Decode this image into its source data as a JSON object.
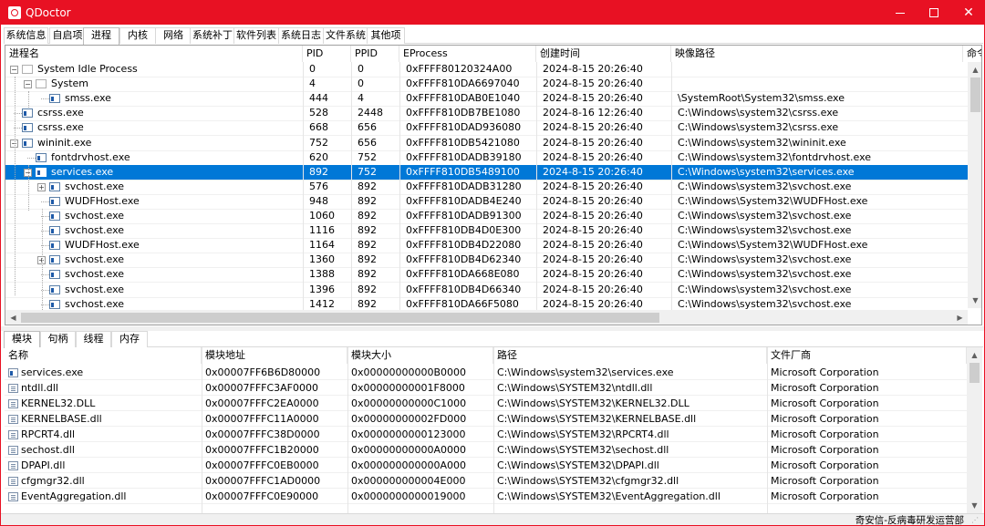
{
  "window": {
    "title": "QDoctor",
    "minimize_icon": "minimize-icon",
    "maximize_icon": "maximize-icon",
    "close_glyph": "✕",
    "accent_color": "#e81123"
  },
  "tabs": [
    "系统信息",
    "自启项",
    "进程",
    "内核",
    "网络",
    "系统补丁",
    "软件列表",
    "系统日志",
    "文件系统",
    "其他项"
  ],
  "active_tab_index": 2,
  "process_table": {
    "columns": [
      "进程名",
      "PID",
      "PPID",
      "EProcess",
      "创建时间",
      "映像路径",
      "命令"
    ],
    "rows": [
      {
        "name": "System Idle Process",
        "pid": "0",
        "ppid": "0",
        "eprocess": "0xFFFF80120324A00",
        "created": "2024-8-15 20:26:40",
        "path": "",
        "level": 0,
        "expander": "−",
        "icon": "blank"
      },
      {
        "name": "System",
        "pid": "4",
        "ppid": "0",
        "eprocess": "0xFFFF810DA6697040",
        "created": "2024-8-15 20:26:40",
        "path": "",
        "level": 1,
        "expander": "−",
        "icon": "blank"
      },
      {
        "name": "smss.exe",
        "pid": "444",
        "ppid": "4",
        "eprocess": "0xFFFF810DAB0E1040",
        "created": "2024-8-15 20:26:40",
        "path": "\\SystemRoot\\System32\\smss.exe",
        "level": 2,
        "expander": "",
        "icon": "exe"
      },
      {
        "name": "csrss.exe",
        "pid": "528",
        "ppid": "2448",
        "eprocess": "0xFFFF810DB7BE1080",
        "created": "2024-8-16 12:26:40",
        "path": "C:\\Windows\\system32\\csrss.exe",
        "level": 0,
        "expander": "",
        "icon": "exe"
      },
      {
        "name": "csrss.exe",
        "pid": "668",
        "ppid": "656",
        "eprocess": "0xFFFF810DAD936080",
        "created": "2024-8-15 20:26:40",
        "path": "C:\\Windows\\system32\\csrss.exe",
        "level": 0,
        "expander": "",
        "icon": "exe"
      },
      {
        "name": "wininit.exe",
        "pid": "752",
        "ppid": "656",
        "eprocess": "0xFFFF810DB5421080",
        "created": "2024-8-15 20:26:40",
        "path": "C:\\Windows\\system32\\wininit.exe",
        "level": 0,
        "expander": "−",
        "icon": "exe"
      },
      {
        "name": "fontdrvhost.exe",
        "pid": "620",
        "ppid": "752",
        "eprocess": "0xFFFF810DADB39180",
        "created": "2024-8-15 20:26:40",
        "path": "C:\\Windows\\system32\\fontdrvhost.exe",
        "level": 1,
        "expander": "",
        "icon": "exe"
      },
      {
        "name": "services.exe",
        "pid": "892",
        "ppid": "752",
        "eprocess": "0xFFFF810DB5489100",
        "created": "2024-8-15 20:26:40",
        "path": "C:\\Windows\\system32\\services.exe",
        "level": 1,
        "expander": "−",
        "icon": "exe",
        "selected": true
      },
      {
        "name": "svchost.exe",
        "pid": "576",
        "ppid": "892",
        "eprocess": "0xFFFF810DADB31280",
        "created": "2024-8-15 20:26:40",
        "path": "C:\\Windows\\system32\\svchost.exe",
        "level": 2,
        "expander": "+",
        "icon": "exe"
      },
      {
        "name": "WUDFHost.exe",
        "pid": "948",
        "ppid": "892",
        "eprocess": "0xFFFF810DADB4E240",
        "created": "2024-8-15 20:26:40",
        "path": "C:\\Windows\\System32\\WUDFHost.exe",
        "level": 2,
        "expander": "",
        "icon": "exe"
      },
      {
        "name": "svchost.exe",
        "pid": "1060",
        "ppid": "892",
        "eprocess": "0xFFFF810DADB91300",
        "created": "2024-8-15 20:26:40",
        "path": "C:\\Windows\\system32\\svchost.exe",
        "level": 2,
        "expander": "",
        "icon": "exe"
      },
      {
        "name": "svchost.exe",
        "pid": "1116",
        "ppid": "892",
        "eprocess": "0xFFFF810DB4D0E300",
        "created": "2024-8-15 20:26:40",
        "path": "C:\\Windows\\system32\\svchost.exe",
        "level": 2,
        "expander": "",
        "icon": "exe"
      },
      {
        "name": "WUDFHost.exe",
        "pid": "1164",
        "ppid": "892",
        "eprocess": "0xFFFF810DB4D22080",
        "created": "2024-8-15 20:26:40",
        "path": "C:\\Windows\\System32\\WUDFHost.exe",
        "level": 2,
        "expander": "",
        "icon": "exe"
      },
      {
        "name": "svchost.exe",
        "pid": "1360",
        "ppid": "892",
        "eprocess": "0xFFFF810DB4D62340",
        "created": "2024-8-15 20:26:40",
        "path": "C:\\Windows\\system32\\svchost.exe",
        "level": 2,
        "expander": "+",
        "icon": "exe"
      },
      {
        "name": "svchost.exe",
        "pid": "1388",
        "ppid": "892",
        "eprocess": "0xFFFF810DA668E080",
        "created": "2024-8-15 20:26:40",
        "path": "C:\\Windows\\system32\\svchost.exe",
        "level": 2,
        "expander": "",
        "icon": "exe"
      },
      {
        "name": "svchost.exe",
        "pid": "1396",
        "ppid": "892",
        "eprocess": "0xFFFF810DB4D66340",
        "created": "2024-8-15 20:26:40",
        "path": "C:\\Windows\\system32\\svchost.exe",
        "level": 2,
        "expander": "",
        "icon": "exe"
      },
      {
        "name": "svchost.exe",
        "pid": "1412",
        "ppid": "892",
        "eprocess": "0xFFFF810DA66F5080",
        "created": "2024-8-15 20:26:40",
        "path": "C:\\Windows\\system32\\svchost.exe",
        "level": 2,
        "expander": "",
        "icon": "exe"
      }
    ]
  },
  "bottom_tabs": [
    "模块",
    "句柄",
    "线程",
    "内存"
  ],
  "active_bottom_tab_index": 0,
  "module_table": {
    "columns": [
      "名称",
      "模块地址",
      "模块大小",
      "路径",
      "文件厂商"
    ],
    "rows": [
      {
        "name": "services.exe",
        "base": "0x00007FF6B6D80000",
        "size": "0x00000000000B0000",
        "path": "C:\\Windows\\system32\\services.exe",
        "vendor": "Microsoft Corporation",
        "icon": "exe"
      },
      {
        "name": "ntdll.dll",
        "base": "0x00007FFFC3AF0000",
        "size": "0x00000000001F8000",
        "path": "C:\\Windows\\SYSTEM32\\ntdll.dll",
        "vendor": "Microsoft Corporation",
        "icon": "dll"
      },
      {
        "name": "KERNEL32.DLL",
        "base": "0x00007FFFC2EA0000",
        "size": "0x00000000000C1000",
        "path": "C:\\Windows\\SYSTEM32\\KERNEL32.DLL",
        "vendor": "Microsoft Corporation",
        "icon": "dll"
      },
      {
        "name": "KERNELBASE.dll",
        "base": "0x00007FFFC11A0000",
        "size": "0x00000000002FD000",
        "path": "C:\\Windows\\SYSTEM32\\KERNELBASE.dll",
        "vendor": "Microsoft Corporation",
        "icon": "dll"
      },
      {
        "name": "RPCRT4.dll",
        "base": "0x00007FFFC38D0000",
        "size": "0x0000000000123000",
        "path": "C:\\Windows\\SYSTEM32\\RPCRT4.dll",
        "vendor": "Microsoft Corporation",
        "icon": "dll"
      },
      {
        "name": "sechost.dll",
        "base": "0x00007FFFC1B20000",
        "size": "0x00000000000A0000",
        "path": "C:\\Windows\\SYSTEM32\\sechost.dll",
        "vendor": "Microsoft Corporation",
        "icon": "dll"
      },
      {
        "name": "DPAPI.dll",
        "base": "0x00007FFFC0EB0000",
        "size": "0x000000000000A000",
        "path": "C:\\Windows\\SYSTEM32\\DPAPI.dll",
        "vendor": "Microsoft Corporation",
        "icon": "dll"
      },
      {
        "name": "cfgmgr32.dll",
        "base": "0x00007FFFC1AD0000",
        "size": "0x000000000004E000",
        "path": "C:\\Windows\\SYSTEM32\\cfgmgr32.dll",
        "vendor": "Microsoft Corporation",
        "icon": "dll"
      },
      {
        "name": "EventAggregation.dll",
        "base": "0x00007FFFC0E90000",
        "size": "0x0000000000019000",
        "path": "C:\\Windows\\SYSTEM32\\EventAggregation.dll",
        "vendor": "Microsoft Corporation",
        "icon": "dll"
      }
    ]
  },
  "statusbar": {
    "text": "奇安信-反病毒研发运营部"
  },
  "colors": {
    "selection": "#0078d7",
    "titlebar": "#e81123"
  }
}
